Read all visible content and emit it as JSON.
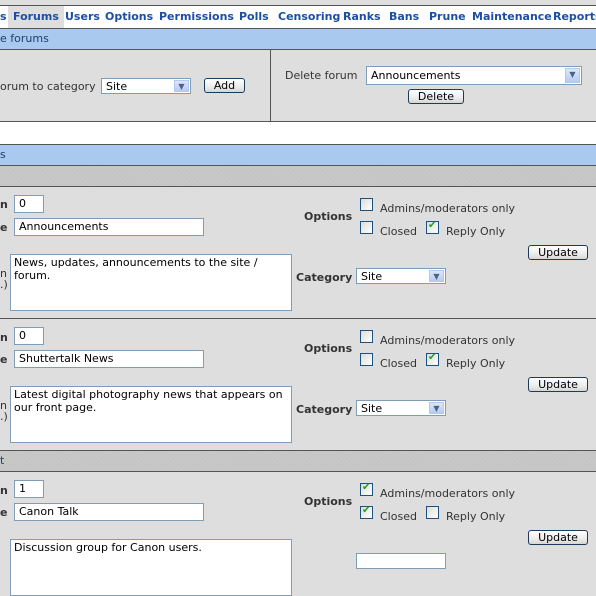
{
  "nav": {
    "items": [
      {
        "label": "s",
        "active": false
      },
      {
        "label": "Forums",
        "active": true
      },
      {
        "label": "Users",
        "active": false
      },
      {
        "label": "Options",
        "active": false
      },
      {
        "label": "Permissions",
        "active": false
      },
      {
        "label": "Polls",
        "active": false
      },
      {
        "label": "Censoring",
        "active": false
      },
      {
        "label": "Ranks",
        "active": false
      },
      {
        "label": "Bans",
        "active": false
      },
      {
        "label": "Prune",
        "active": false
      },
      {
        "label": "Maintenance",
        "active": false
      },
      {
        "label": "Reports",
        "active": false
      }
    ]
  },
  "add_delete": {
    "header": "e forums",
    "add_label": "orum to category",
    "add_category_selected": "Site",
    "add_button": "Add",
    "delete_label": "Delete forum",
    "delete_forum_selected": "Announcements",
    "delete_button": "Delete"
  },
  "edit": {
    "header": "s",
    "field_labels": {
      "position": "n",
      "name": "e",
      "description_1": "n",
      "description_2": ".)",
      "options": "Options",
      "category": "Category",
      "admins_only": "Admins/moderators only",
      "closed": "Closed",
      "reply_only": "Reply Only",
      "update": "Update"
    },
    "forums": [
      {
        "header": "",
        "position": "0",
        "name": "Announcements",
        "description": "News, updates, announcements to the site / forum.",
        "category": "Site",
        "admins_only": false,
        "closed": false,
        "reply_only": true
      },
      {
        "header": "",
        "position": "0",
        "name": "Shuttertalk News",
        "description": "Latest digital photography news that appears on our front page.",
        "category": "Site",
        "admins_only": false,
        "closed": false,
        "reply_only": true
      },
      {
        "header": "t",
        "position": "1",
        "name": "Canon Talk",
        "description": "Discussion group for Canon users.",
        "category": "",
        "admins_only": true,
        "closed": true,
        "reply_only": false
      }
    ]
  },
  "icons": {
    "dropdown": "▼",
    "check": "✔"
  }
}
